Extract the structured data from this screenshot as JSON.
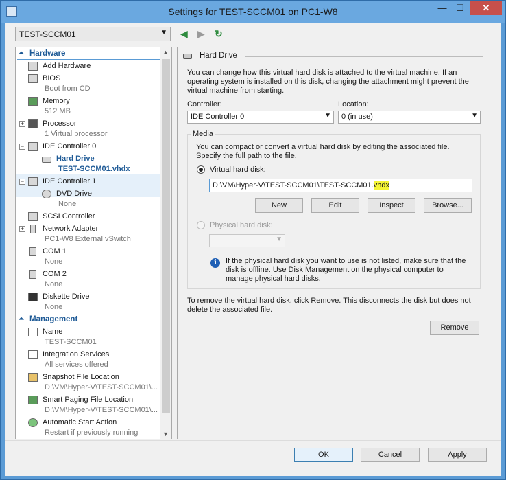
{
  "window": {
    "title": "Settings for TEST-SCCM01 on PC1-W8",
    "min_glyph": "—",
    "max_glyph": "☐",
    "close_glyph": "✕"
  },
  "vm_selector": {
    "value": "TEST-SCCM01"
  },
  "tree": {
    "hardware_header": "Hardware",
    "management_header": "Management",
    "items": {
      "add_hardware": {
        "label": "Add Hardware"
      },
      "bios": {
        "label": "BIOS",
        "sub": "Boot from CD"
      },
      "memory": {
        "label": "Memory",
        "sub": "512 MB"
      },
      "processor": {
        "label": "Processor",
        "sub": "1 Virtual processor"
      },
      "ide0": {
        "label": "IDE Controller 0"
      },
      "hard_drive": {
        "label": "Hard Drive",
        "sub": "TEST-SCCM01.vhdx"
      },
      "ide1": {
        "label": "IDE Controller 1"
      },
      "dvd": {
        "label": "DVD Drive",
        "sub": "None"
      },
      "scsi": {
        "label": "SCSI Controller"
      },
      "network": {
        "label": "Network Adapter",
        "sub": "PC1-W8 External vSwitch"
      },
      "com1": {
        "label": "COM 1",
        "sub": "None"
      },
      "com2": {
        "label": "COM 2",
        "sub": "None"
      },
      "diskette": {
        "label": "Diskette Drive",
        "sub": "None"
      },
      "name": {
        "label": "Name",
        "sub": "TEST-SCCM01"
      },
      "integration": {
        "label": "Integration Services",
        "sub": "All services offered"
      },
      "snapshot": {
        "label": "Snapshot File Location",
        "sub": "D:\\VM\\Hyper-V\\TEST-SCCM01\\..."
      },
      "smart_paging": {
        "label": "Smart Paging File Location",
        "sub": "D:\\VM\\Hyper-V\\TEST-SCCM01\\..."
      },
      "auto_start": {
        "label": "Automatic Start Action",
        "sub": "Restart if previously running"
      }
    }
  },
  "panel": {
    "title": "Hard Drive",
    "intro": "You can change how this virtual hard disk is attached to the virtual machine. If an operating system is installed on this disk, changing the attachment might prevent the virtual machine from starting.",
    "controller_label": "Controller:",
    "controller_value": "IDE Controller 0",
    "location_label": "Location:",
    "location_value": "0 (in use)",
    "media_title": "Media",
    "media_text": "You can compact or convert a virtual hard disk by editing the associated file. Specify the full path to the file.",
    "vhd_radio": "Virtual hard disk:",
    "vhd_path_prefix": "D:\\VM\\Hyper-V\\TEST-SCCM01\\TEST-SCCM01.",
    "vhd_path_ext": "vhdx",
    "buttons": {
      "new": "New",
      "edit": "Edit",
      "inspect": "Inspect",
      "browse": "Browse..."
    },
    "phys_radio": "Physical hard disk:",
    "info_text": "If the physical hard disk you want to use is not listed, make sure that the disk is offline. Use Disk Management on the physical computer to manage physical hard disks.",
    "remove_text": "To remove the virtual hard disk, click Remove. This disconnects the disk but does not delete the associated file.",
    "remove_button": "Remove"
  },
  "footer": {
    "ok": "OK",
    "cancel": "Cancel",
    "apply": "Apply"
  }
}
